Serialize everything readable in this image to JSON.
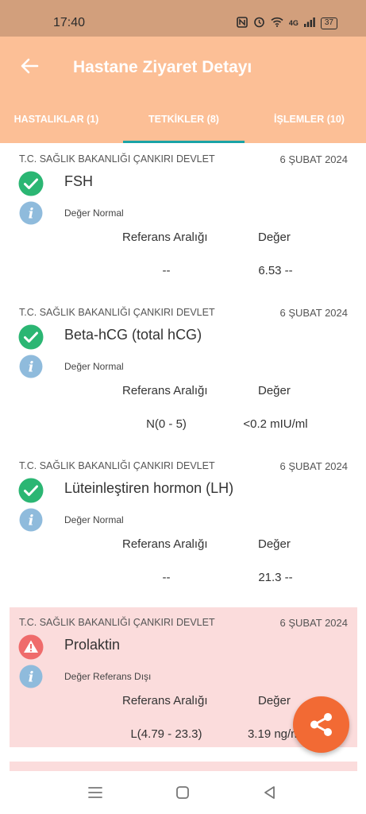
{
  "status_bar": {
    "time": "17:40",
    "battery": "37",
    "network": "4G"
  },
  "header": {
    "title": "Hastane Ziyaret Detayı"
  },
  "tabs": [
    {
      "label": "HASTALIKLAR (1)"
    },
    {
      "label": "TETKİKLER (8)"
    },
    {
      "label": "İŞLEMLER (10)"
    }
  ],
  "labels": {
    "ref_header": "Referans Aralığı",
    "value_header": "Değer"
  },
  "tests": [
    {
      "hospital": "T.C. SAĞLIK BAKANLIĞI ÇANKIRI DEVLET",
      "date": "6 ŞUBAT 2024",
      "name": "FSH",
      "note": "Değer Normal",
      "ref": "--",
      "value": "6.53 --",
      "status": "normal"
    },
    {
      "hospital": "T.C. SAĞLIK BAKANLIĞI ÇANKIRI DEVLET",
      "date": "6 ŞUBAT 2024",
      "name": "Beta-hCG (total hCG)",
      "note": "Değer Normal",
      "ref": "N(0 - 5)",
      "value": "<0.2 mIU/ml",
      "status": "normal"
    },
    {
      "hospital": "T.C. SAĞLIK BAKANLIĞI ÇANKIRI DEVLET",
      "date": "6 ŞUBAT 2024",
      "name": "Lüteinleştiren hormon (LH)",
      "note": "Değer Normal",
      "ref": "--",
      "value": "21.3 --",
      "status": "normal"
    },
    {
      "hospital": "T.C. SAĞLIK BAKANLIĞI ÇANKIRI DEVLET",
      "date": "6 ŞUBAT 2024",
      "name": "Prolaktin",
      "note": "Değer Referans Dışı",
      "ref": "L(4.79 - 23.3)",
      "value": "3.19 ng/ml",
      "status": "alert"
    }
  ],
  "colors": {
    "header": "#fcbf96",
    "status_bar": "#d29f7c",
    "tab_indicator": "#1aa3a6",
    "ok": "#2bb673",
    "info": "#8fbbdc",
    "alert": "#ef6b6b",
    "alert_bg": "#fbdcdc",
    "fab": "#f26a34"
  }
}
